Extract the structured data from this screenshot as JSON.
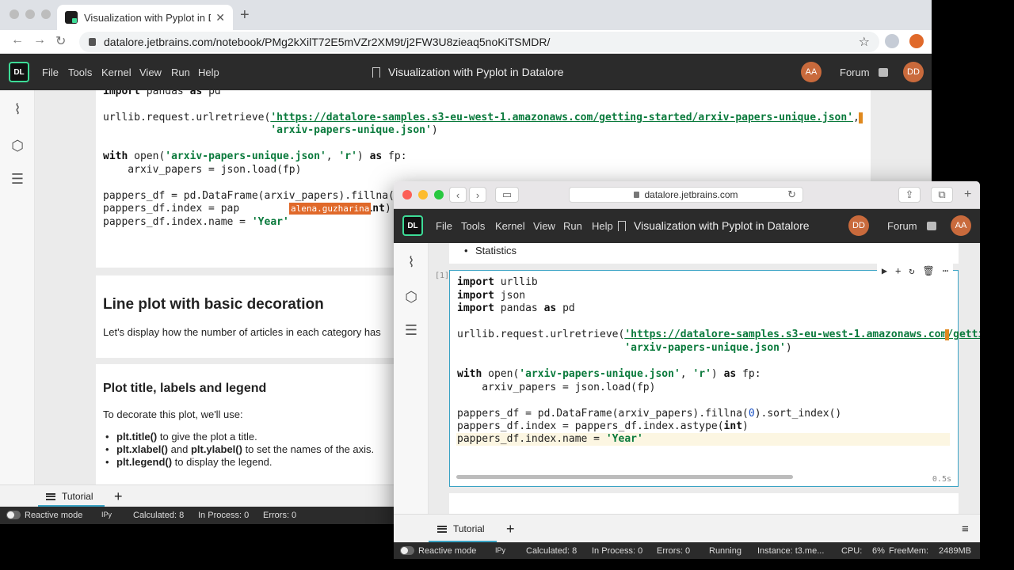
{
  "browser_back": {
    "tab_title": "Visualization with Pyplot in Data",
    "url": "datalore.jetbrains.com/notebook/PMg2kXilT72E5mVZr2XM9t/j2FW3U8zieaq5noKiTSMDR/"
  },
  "browser_front": {
    "url": "datalore.jetbrains.com"
  },
  "app": {
    "logo": "DL",
    "menu": [
      "File",
      "Tools",
      "Kernel",
      "View",
      "Run",
      "Help"
    ],
    "notebook_title": "Visualization with Pyplot in Datalore",
    "forum_label": "Forum",
    "avatar_aa": "AA",
    "avatar_dd": "DD"
  },
  "back_notebook": {
    "code_lines": [
      "import pandas as pd",
      "urllib.request.urlretrieve('https://datalore-samples.s3-eu-west-1.amazonaws.com/getting-started/arxiv-papers-unique.json',",
      "                           'arxiv-papers-unique.json')",
      "with open('arxiv-papers-unique.json', 'r') as fp:",
      "    arxiv_papers = json.load(fp)",
      "pappers_df = pd.DataFrame(arxiv_papers).fillna(0).s",
      "pappers_df.index = pap",
      "ex.astype(int)",
      "pappers_df.index.name = 'Year'"
    ],
    "collab_cursor": "alena.guzharina",
    "section_title": "Line plot with basic decoration",
    "section_text": "Let's display how the number of articles in each category has",
    "sub_title": "Plot title, labels and legend",
    "sub_text": "To decorate this plot, we'll use:",
    "bullets": [
      {
        "code": "plt.title()",
        "rest": " to give the plot a title."
      },
      {
        "code": "plt.xlabel()",
        "mid": " and ",
        "code2": "plt.ylabel()",
        "rest": " to set the names of the axis."
      },
      {
        "code": "plt.legend()",
        "rest": " to display the legend."
      }
    ],
    "tab_label": "Tutorial"
  },
  "back_status": {
    "reactive": "Reactive mode",
    "ipy": "IPy",
    "calculated": "Calculated: 8",
    "in_process": "In Process: 0",
    "errors": "Errors: 0"
  },
  "front_notebook": {
    "prev_bullet": "Statistics",
    "cell_number": "[1]",
    "code_lines": [
      "import urllib",
      "import json",
      "import pandas as pd",
      "urllib.request.urlretrieve('https://datalore-samples.s3-eu-west-1.amazonaws.com/gettin",
      "                           'arxiv-papers-unique.json')",
      "with open('arxiv-papers-unique.json', 'r') as fp:",
      "    arxiv_papers = json.load(fp)",
      "pappers_df = pd.DataFrame(arxiv_papers).fillna(0).sort_index()",
      "pappers_df.index = pappers_df.index.astype(int)",
      "pappers_df.index.name = 'Year'"
    ],
    "exec_time": "0.5s",
    "tab_label": "Tutorial"
  },
  "front_status": {
    "reactive": "Reactive mode",
    "ipy": "IPy",
    "calculated": "Calculated: 8",
    "in_process": "In Process: 0",
    "errors": "Errors: 0",
    "running": "Running",
    "instance": "Instance: t3.me...",
    "cpu": "CPU:",
    "cpu_val": "6%",
    "freemem": "FreeMem:",
    "freemem_val": "2489MB"
  }
}
